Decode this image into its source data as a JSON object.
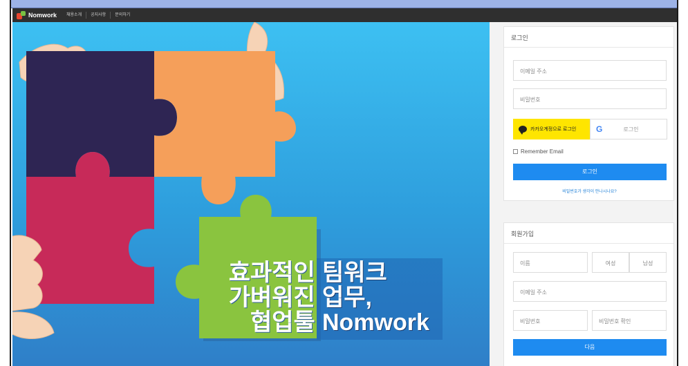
{
  "navbar": {
    "logo_text": "Nomwork",
    "items": [
      "채용소개",
      "공지사항",
      "문의하기"
    ]
  },
  "hero": {
    "headline_left": [
      "효과적인",
      "가벼워진",
      "협업툴"
    ],
    "headline_right": [
      "팀워크",
      "업무,",
      "Nomwork"
    ],
    "colors": {
      "piece_navy": "#2e2553",
      "piece_orange": "#f59f5a",
      "piece_crimson": "#c72a59",
      "piece_green": "#8ac43f",
      "headline_right_bg": "#1f66b3"
    }
  },
  "login": {
    "title": "로그인",
    "email_placeholder": "이메일 주소",
    "password_placeholder": "비밀번호",
    "kakao_label": "카카오계정으로 로그인",
    "google_label": "로그인",
    "remember_label": "Remember Email",
    "submit_label": "로그인",
    "forgot_link": "비밀번호가 생각이 안나시나요?"
  },
  "signup": {
    "title": "회원가입",
    "name_placeholder": "이름",
    "gender_female": "여성",
    "gender_male": "남성",
    "email_placeholder": "이메일 주소",
    "password_placeholder": "비밀번호",
    "password_confirm_placeholder": "비밀번호 확인",
    "next_label": "다음"
  }
}
